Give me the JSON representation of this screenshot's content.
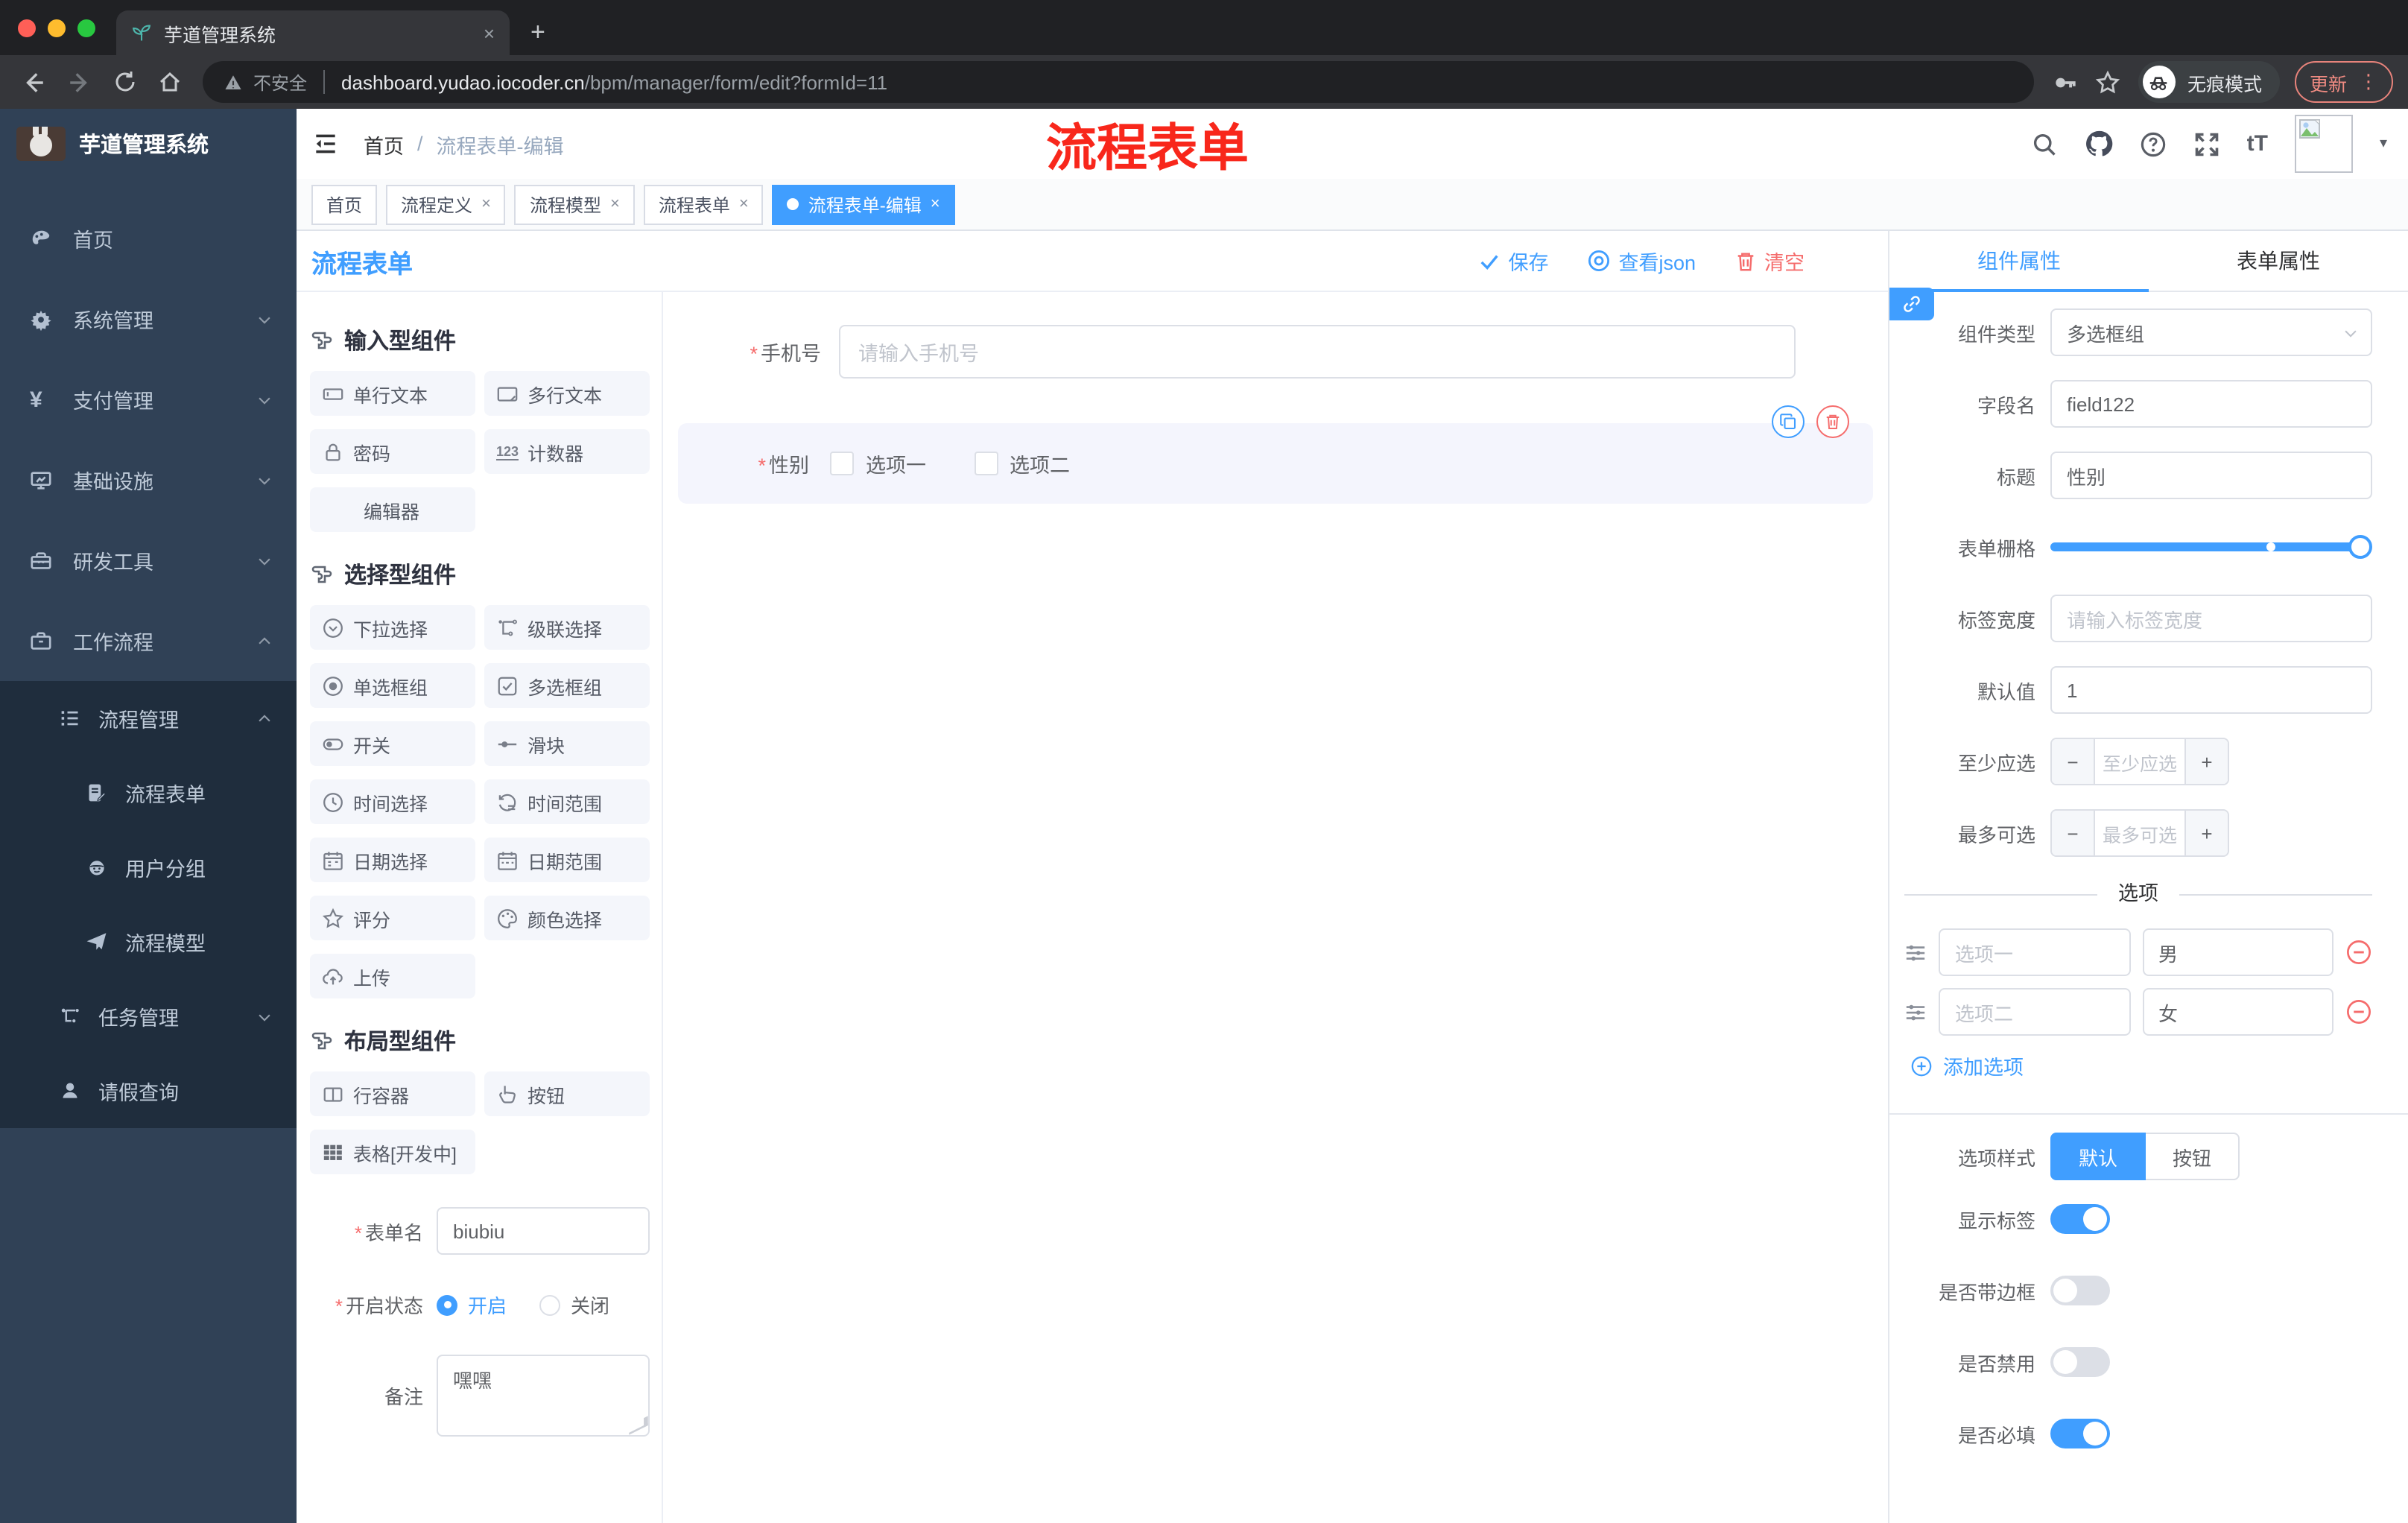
{
  "glyphs": {
    "close": "×",
    "plus": "+",
    "minus": "−",
    "dots": "⋮",
    "caret": "▾",
    "slash": "/",
    "star": "*",
    "tT": "tT",
    "counter": "123",
    "yen": "¥"
  },
  "browser": {
    "tab_title": "芋道管理系统",
    "security": "不安全",
    "host": "dashboard.yudao.iocoder.cn",
    "path": "/bpm/manager/form/edit?formId=11",
    "incognito": "无痕模式",
    "update": "更新"
  },
  "annotation": {
    "text": "流程表单"
  },
  "sidebar": {
    "logo_title": "芋道管理系统",
    "items": [
      {
        "label": "首页"
      },
      {
        "label": "系统管理"
      },
      {
        "label": "支付管理"
      },
      {
        "label": "基础设施"
      },
      {
        "label": "研发工具"
      },
      {
        "label": "工作流程"
      },
      {
        "label": "流程管理"
      },
      {
        "label": "流程表单"
      },
      {
        "label": "用户分组"
      },
      {
        "label": "流程模型"
      },
      {
        "label": "任务管理"
      },
      {
        "label": "请假查询"
      }
    ]
  },
  "breadcrumb": {
    "home": "首页",
    "current": "流程表单-编辑"
  },
  "tags": [
    {
      "label": "首页"
    },
    {
      "label": "流程定义"
    },
    {
      "label": "流程模型"
    },
    {
      "label": "流程表单"
    },
    {
      "label": "流程表单-编辑"
    }
  ],
  "editor": {
    "title": "流程表单",
    "save": "保存",
    "view_json": "查看json",
    "clear": "清空"
  },
  "palette": {
    "sections": [
      {
        "title": "输入型组件",
        "items": [
          {
            "label": "单行文本"
          },
          {
            "label": "多行文本"
          },
          {
            "label": "密码"
          },
          {
            "label": "计数器"
          },
          {
            "label": "编辑器"
          }
        ]
      },
      {
        "title": "选择型组件",
        "items": [
          {
            "label": "下拉选择"
          },
          {
            "label": "级联选择"
          },
          {
            "label": "单选框组"
          },
          {
            "label": "多选框组"
          },
          {
            "label": "开关"
          },
          {
            "label": "滑块"
          },
          {
            "label": "时间选择"
          },
          {
            "label": "时间范围"
          },
          {
            "label": "日期选择"
          },
          {
            "label": "日期范围"
          },
          {
            "label": "评分"
          },
          {
            "label": "颜色选择"
          },
          {
            "label": "上传"
          }
        ]
      },
      {
        "title": "布局型组件",
        "items": [
          {
            "label": "行容器"
          },
          {
            "label": "按钮"
          },
          {
            "label": "表格[开发中]"
          }
        ]
      }
    ]
  },
  "meta_form": {
    "name_label": "表单名",
    "name_value": "biubiu",
    "status_label": "开启状态",
    "status_on": "开启",
    "status_off": "关闭",
    "remark_label": "备注",
    "remark_value": "嘿嘿"
  },
  "canvas": {
    "phone_label": "手机号",
    "phone_placeholder": "请输入手机号",
    "gender_label": "性别",
    "option1": "选项一",
    "option2": "选项二"
  },
  "panel": {
    "tab_component": "组件属性",
    "tab_form": "表单属性",
    "type_label": "组件类型",
    "type_value": "多选框组",
    "field_label": "字段名",
    "field_value": "field122",
    "title_label": "标题",
    "title_value": "性别",
    "grid_label": "表单栅格",
    "label_width_label": "标签宽度",
    "label_width_placeholder": "请输入标签宽度",
    "default_label": "默认值",
    "default_value": "1",
    "min_label": "至少应选",
    "min_placeholder": "至少应选",
    "max_label": "最多可选",
    "max_placeholder": "最多可选",
    "options_title": "选项",
    "options": [
      {
        "label": "选项一",
        "value": "男"
      },
      {
        "label": "选项二",
        "value": "女"
      }
    ],
    "add_option": "添加选项",
    "style_label": "选项样式",
    "style_default": "默认",
    "style_button": "按钮",
    "show_label": "显示标签",
    "border_label": "是否带边框",
    "disabled_label": "是否禁用",
    "required_label": "是否必填"
  },
  "colors": {
    "accent": "#409eff",
    "danger": "#f56c6c",
    "annotation": "#f8271b",
    "sidebar": "#304156",
    "submenu": "#1f2d3d"
  }
}
